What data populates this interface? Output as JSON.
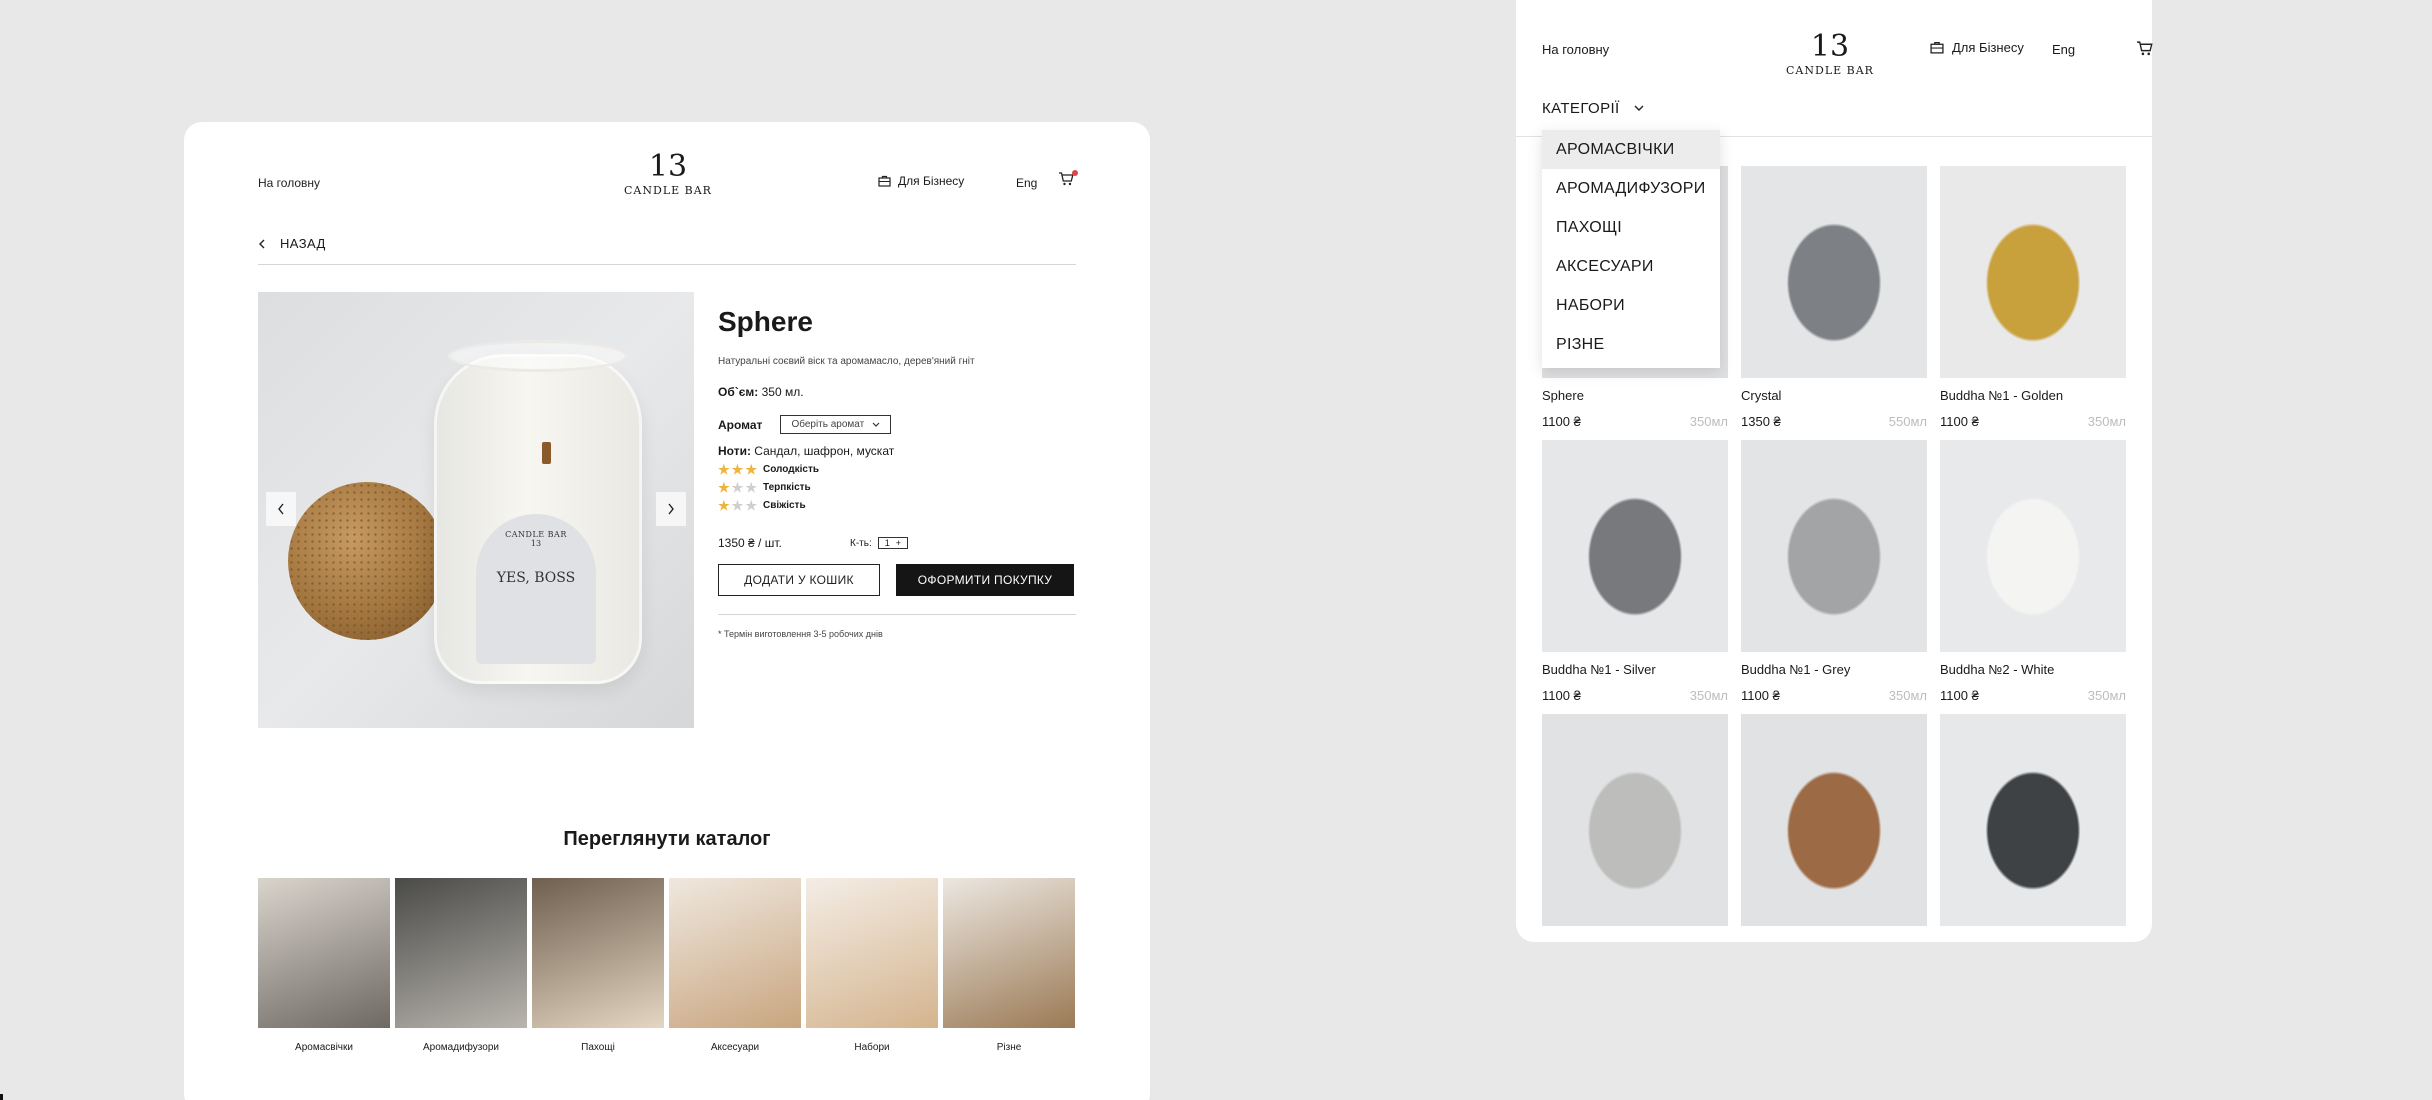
{
  "colors": {
    "background": "#e8e8e8",
    "card": "#ffffff",
    "dark_button": "#151515",
    "star_active": "#f0b43a",
    "star_inactive": "#cfcfcf",
    "cart_dot": "#e04545",
    "volume_text": "#bdbdbd"
  },
  "product_page": {
    "header": {
      "home": "На головну",
      "logo_number": "13",
      "logo_name": "CANDLE BAR",
      "business": "Для Бізнесу",
      "lang": "Eng",
      "cart_icon": "cart-icon",
      "business_icon": "briefcase-icon"
    },
    "back_label": "НАЗАД",
    "photo": {
      "label_line1": "CANDLE BAR",
      "label_line2": "13",
      "label_line3": "YES, BOSS"
    },
    "product": {
      "title": "Sphere",
      "description": "Натуральні соєвий віск та аромамасло, дерев'яний гніт",
      "volume_label": "Об`єм:",
      "volume_value": "350 мл.",
      "aroma_label": "Аромат",
      "aroma_select": "Оберіть аромат",
      "notes_label": "Ноти:",
      "notes_value": "Сандал, шафрон, мускат",
      "ratings": [
        {
          "label": "Солодкість",
          "value": 3,
          "max": 3
        },
        {
          "label": "Терпкість",
          "value": 1,
          "max": 3
        },
        {
          "label": "Свіжість",
          "value": 1,
          "max": 3
        }
      ],
      "price": "1350 ₴ / шт.",
      "qty_label": "К-ть:",
      "qty_value": "1",
      "qty_stepper": "+",
      "add_to_cart": "ДОДАТИ У КОШИК",
      "checkout": "ОФОРМИТИ ПОКУПКУ",
      "lead_time_note": "* Термін виготовлення 3-5 робочих днів"
    },
    "catalog": {
      "title": "Переглянути каталог",
      "items": [
        {
          "label": "Аромасвічки",
          "c1": "#d9d4cc",
          "c2": "#6e6963"
        },
        {
          "label": "Аромадифузори",
          "c1": "#4a4a48",
          "c2": "#b9b5ae"
        },
        {
          "label": "Пахощі",
          "c1": "#6f5f4f",
          "c2": "#e4d6c2"
        },
        {
          "label": "Аксесуари",
          "c1": "#efe8df",
          "c2": "#c9a57f"
        },
        {
          "label": "Набори",
          "c1": "#f4ede6",
          "c2": "#d4b48e"
        },
        {
          "label": "Різне",
          "c1": "#ece7e1",
          "c2": "#9b7a55"
        }
      ]
    }
  },
  "category_page": {
    "header": {
      "home": "На головну",
      "logo_number": "13",
      "logo_name": "CANDLE BAR",
      "business": "Для Бізнесу",
      "lang": "Eng"
    },
    "categories_label": "КАТЕГОРІЇ",
    "dropdown": [
      "АРОМАСВІЧКИ",
      "АРОМАДИФУЗОРИ",
      "ПАХОЩІ",
      "АКСЕСУАРИ",
      "НАБОРИ",
      "РІЗНЕ"
    ],
    "dropdown_active": 0,
    "products": [
      {
        "name": "Sphere",
        "price": "1100 ₴",
        "volume": "350мл",
        "c1": "#dfe0e2",
        "c2": "#ecebe7"
      },
      {
        "name": "Crystal",
        "price": "1350 ₴",
        "volume": "550мл",
        "c1": "#e4e5e7",
        "c2": "#7d8084"
      },
      {
        "name": "Buddha №1 - Golden",
        "price": "1100 ₴",
        "volume": "350мл",
        "c1": "#e9e9ea",
        "c2": "#c9a13c"
      },
      {
        "name": "Buddha №1 - Silver",
        "price": "1100 ₴",
        "volume": "350мл",
        "c1": "#e6e7e9",
        "c2": "#77797c"
      },
      {
        "name": "Buddha №1 - Grey",
        "price": "1100 ₴",
        "volume": "350мл",
        "c1": "#e3e4e6",
        "c2": "#a3a4a5"
      },
      {
        "name": "Buddha №2 - White",
        "price": "1100 ₴",
        "volume": "350мл",
        "c1": "#e8e9eb",
        "c2": "#f4f4f3"
      },
      {
        "name": "",
        "price": "",
        "volume": "",
        "c1": "#e1e2e3",
        "c2": "#bdbdbc"
      },
      {
        "name": "",
        "price": "",
        "volume": "",
        "c1": "#e1e2e3",
        "c2": "#9c6a45"
      },
      {
        "name": "",
        "price": "",
        "volume": "",
        "c1": "#e7e8ea",
        "c2": "#3f4245"
      }
    ]
  }
}
